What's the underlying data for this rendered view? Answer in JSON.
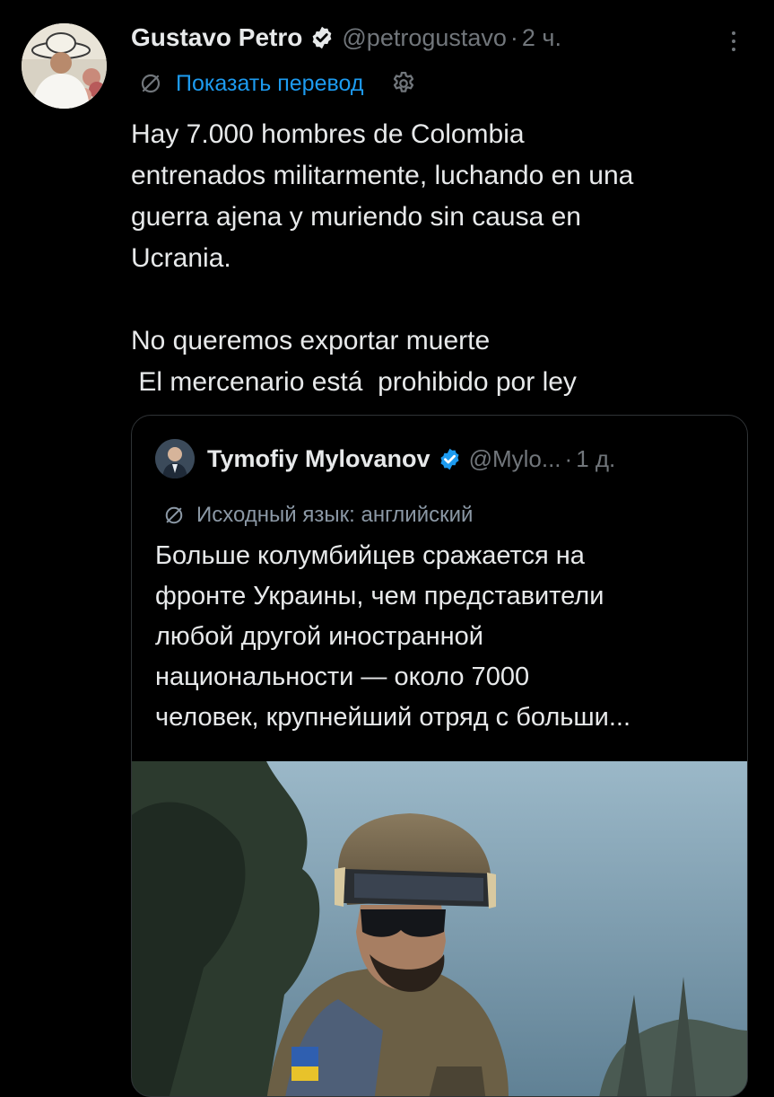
{
  "tweet": {
    "author_name": "Gustavo Petro",
    "handle": "@petrogustavo",
    "separator": "·",
    "time": "2 ч.",
    "translate_label": "Показать перевод",
    "body_lines_1": [
      "Hay 7.000 hombres de Colombia",
      "entrenados militarmente, luchando en una",
      "guerra ajena y muriendo sin causa en",
      "Ucrania."
    ],
    "body_lines_2": [
      "No queremos exportar muerte",
      " El mercenario está  prohibido por ley"
    ]
  },
  "quoted": {
    "author_name": "Tymofiy Mylovanov",
    "handle": "@Mylo...",
    "separator": "·",
    "time": "1 д.",
    "language_label": "Исходный язык: английский",
    "body_lines": [
      "Больше колумбийцев сражается на",
      "фронте Украины, чем представители",
      "любой другой иностранной",
      "национальности — около 7000",
      "человек, крупнейший отряд с больши..."
    ]
  },
  "colors": {
    "background": "#000000",
    "text": "#e7e9ea",
    "muted": "#71767b",
    "link": "#1d9bf0",
    "verified": "#1d9bf0",
    "border": "#2f3336"
  },
  "icons": {
    "verified": "verified-badge-icon",
    "more": "more-options-icon",
    "translate": "translate-icon",
    "settings": "gear-icon",
    "language": "translate-icon"
  }
}
